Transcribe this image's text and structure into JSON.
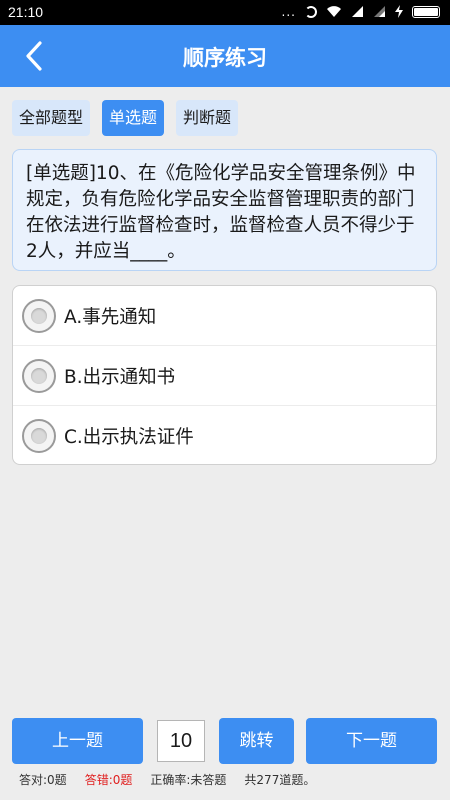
{
  "status_bar": {
    "time": "21:10",
    "signal_dots": "..."
  },
  "header": {
    "title": "顺序练习"
  },
  "tabs": [
    {
      "label": "全部题型",
      "active": false
    },
    {
      "label": "单选题",
      "active": true
    },
    {
      "label": "判断题",
      "active": false
    }
  ],
  "question": {
    "text": "[单选题]10、在《危险化学品安全管理条例》中规定，负有危险化学品安全监督管理职责的部门在依法进行监督检查时，监督检查人员不得少于2人，并应当____。"
  },
  "options": [
    {
      "label": "A.事先通知"
    },
    {
      "label": "B.出示通知书"
    },
    {
      "label": "C.出示执法证件"
    }
  ],
  "navigation": {
    "prev_label": "上一题",
    "page_value": "10",
    "jump_label": "跳转",
    "next_label": "下一题"
  },
  "stats": {
    "correct": "答对:0题",
    "wrong": "答错:0题",
    "accuracy": "正确率:未答题",
    "total": "共277道题。"
  },
  "colors": {
    "primary": "#3d8ef2",
    "tab_bg": "#d8e7fa",
    "question_bg": "#eaf2fd",
    "wrong": "#e02020"
  }
}
